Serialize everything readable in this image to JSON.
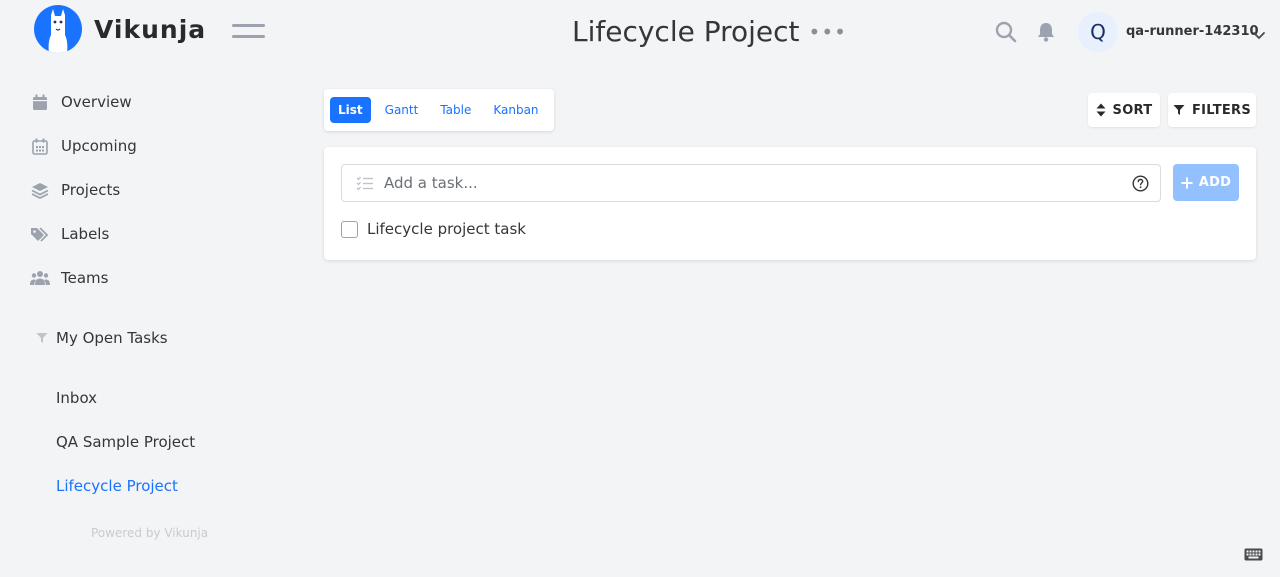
{
  "app": {
    "name": "Vikunja"
  },
  "header": {
    "title": "Lifecycle Project",
    "title_menu": "•••",
    "user": {
      "initial": "Q",
      "name": "qa-runner-142310"
    }
  },
  "sidebar": {
    "nav": [
      {
        "label": "Overview",
        "icon": "calendar-icon"
      },
      {
        "label": "Upcoming",
        "icon": "calendar-grid-icon"
      },
      {
        "label": "Projects",
        "icon": "layers-icon"
      },
      {
        "label": "Labels",
        "icon": "tags-icon"
      },
      {
        "label": "Teams",
        "icon": "users-icon"
      }
    ],
    "saved_filter": {
      "label": "My Open Tasks",
      "icon": "filter-icon"
    },
    "projects": [
      {
        "label": "Inbox"
      },
      {
        "label": "QA Sample Project"
      },
      {
        "label": "Lifecycle Project",
        "active": true
      }
    ],
    "powered_by": "Powered by Vikunja"
  },
  "views": {
    "tabs": [
      {
        "label": "List",
        "active": true
      },
      {
        "label": "Gantt"
      },
      {
        "label": "Table"
      },
      {
        "label": "Kanban"
      }
    ]
  },
  "toolbar": {
    "sort_label": "SORT",
    "filters_label": "FILTERS"
  },
  "task_input": {
    "placeholder": "Add a task...",
    "value": "",
    "add_label": "ADD"
  },
  "tasks": [
    {
      "title": "Lifecycle project task",
      "done": false
    }
  ],
  "colors": {
    "accent": "#1973ff",
    "add_button": "#93c0ff",
    "background": "#f3f4f6"
  }
}
